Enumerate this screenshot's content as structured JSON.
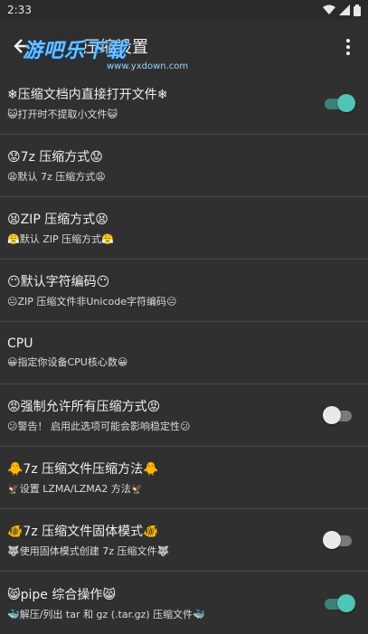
{
  "status": {
    "time": "2:33"
  },
  "toolbar": {
    "title": "压缩设置",
    "watermark": "游吧乐下载",
    "watermark_sub": "www.yxdown.com"
  },
  "colors": {
    "accent": "#4fc5b5",
    "background": "#303030"
  },
  "settings": [
    {
      "title": "❄压缩文档内直接打开文件❄",
      "subtitle": "😺打开时不提取小文件😺",
      "toggle": "on"
    },
    {
      "title": "😟7z 压缩方式😟",
      "subtitle": "😩默认 7z 压缩方式😩",
      "toggle": null
    },
    {
      "title": "😫ZIP 压缩方式😫",
      "subtitle": "😤默认 ZIP 压缩方式😤",
      "toggle": null
    },
    {
      "title": "😶默认字符编码😶",
      "subtitle": "😐ZIP 压缩文件非Unicode字符编码😐",
      "toggle": null
    },
    {
      "title": "CPU",
      "subtitle": "😀指定你设备CPU核心数😀",
      "toggle": null
    },
    {
      "title": "😡强制允许所有压缩方式😡",
      "subtitle": "😕警告！ 启用此选项可能会影响稳定性😕",
      "toggle": "off"
    },
    {
      "title": "🐥7z 压缩文件压缩方法🐥",
      "subtitle": "🦅设置 LZMA/LZMA2 方法🦅",
      "toggle": null
    },
    {
      "title": "🐠7z 压缩文件固体模式🐠",
      "subtitle": "🐺使用固体模式创建 7z 压缩文件🐺",
      "toggle": "off"
    },
    {
      "title": "😸pipe 综合操作😸",
      "subtitle": "🐳解压/列出 tar 和 gz (.tar.gz) 压缩文件🐳",
      "toggle": "on"
    }
  ]
}
